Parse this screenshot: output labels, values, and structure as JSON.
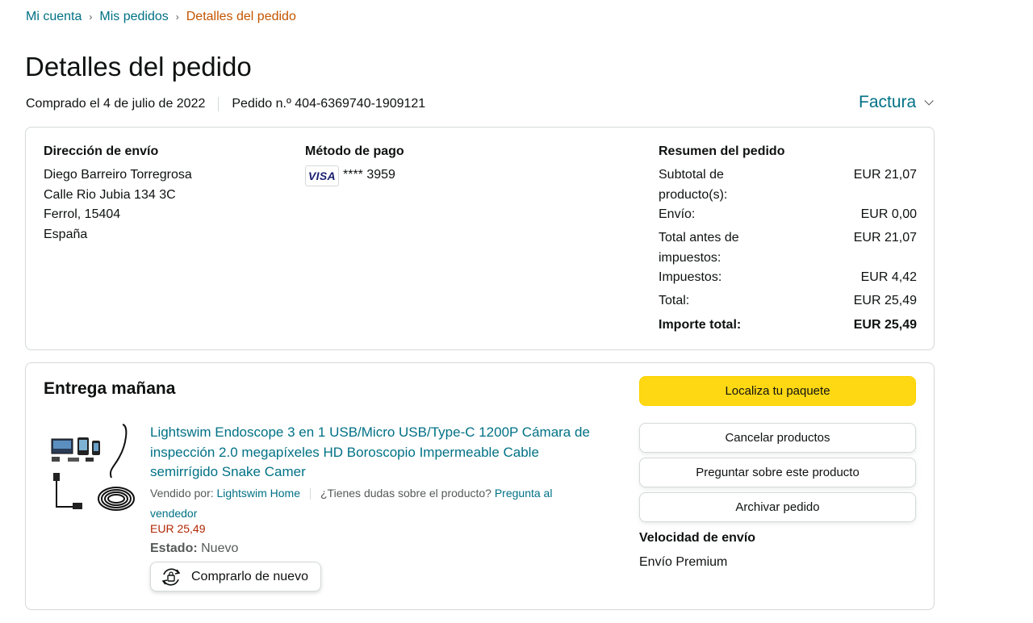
{
  "breadcrumb": {
    "items": [
      "Mi cuenta",
      "Mis pedidos"
    ],
    "current": "Detalles del pedido"
  },
  "page": {
    "title": "Detalles del pedido",
    "purchased": "Comprado el 4 de julio de 2022",
    "order_number": "Pedido n.º 404-6369740-1909121",
    "invoice_label": "Factura"
  },
  "shipping": {
    "title": "Dirección de envío",
    "lines": [
      "Diego Barreiro Torregrosa",
      "Calle Rio Jubia 134 3C",
      "Ferrol, 15404",
      "España"
    ]
  },
  "payment": {
    "title": "Método de pago",
    "card_brand": "VISA",
    "card_number": "**** 3959"
  },
  "summary": {
    "title": "Resumen del pedido",
    "rows": [
      {
        "label": "Subtotal de producto(s):",
        "value": "EUR 21,07"
      },
      {
        "label": "Envío:",
        "value": "EUR 0,00"
      },
      {
        "label": "Total antes de impuestos:",
        "value": "EUR 21,07"
      },
      {
        "label": "Impuestos:",
        "value": "EUR 4,42"
      },
      {
        "label": "Total:",
        "value": "EUR 25,49"
      },
      {
        "label": "Importe total:",
        "value": "EUR 25,49"
      }
    ]
  },
  "delivery": {
    "title": "Entrega mañana",
    "product": {
      "title": "Lightswim Endoscope 3 en 1 USB/Micro USB/Type-C 1200P Cámara de inspección 2.0 megapíxeles HD Boroscopio Impermeable Cable semirrígido Snake Camer",
      "sold_by_label": "Vendido por:",
      "seller": "Lightswim Home",
      "question_text": "¿Tienes dudas sobre el producto?",
      "question_link": "Pregunta al vendedor",
      "price": "EUR 25,49",
      "status_label": "Estado:",
      "status_value": "Nuevo",
      "buy_again_label": "Comprarlo de nuevo"
    },
    "actions": {
      "track": "Localiza tu paquete",
      "cancel": "Cancelar productos",
      "ask": "Preguntar sobre este producto",
      "archive": "Archivar pedido"
    },
    "speed_title": "Velocidad de envío",
    "speed_value": "Envío Premium"
  },
  "colors": {
    "link": "#007185",
    "breadcrumb_current": "#c45500",
    "price": "#b12704",
    "primary_button": "#ffd814",
    "border": "#d5d9d9"
  }
}
